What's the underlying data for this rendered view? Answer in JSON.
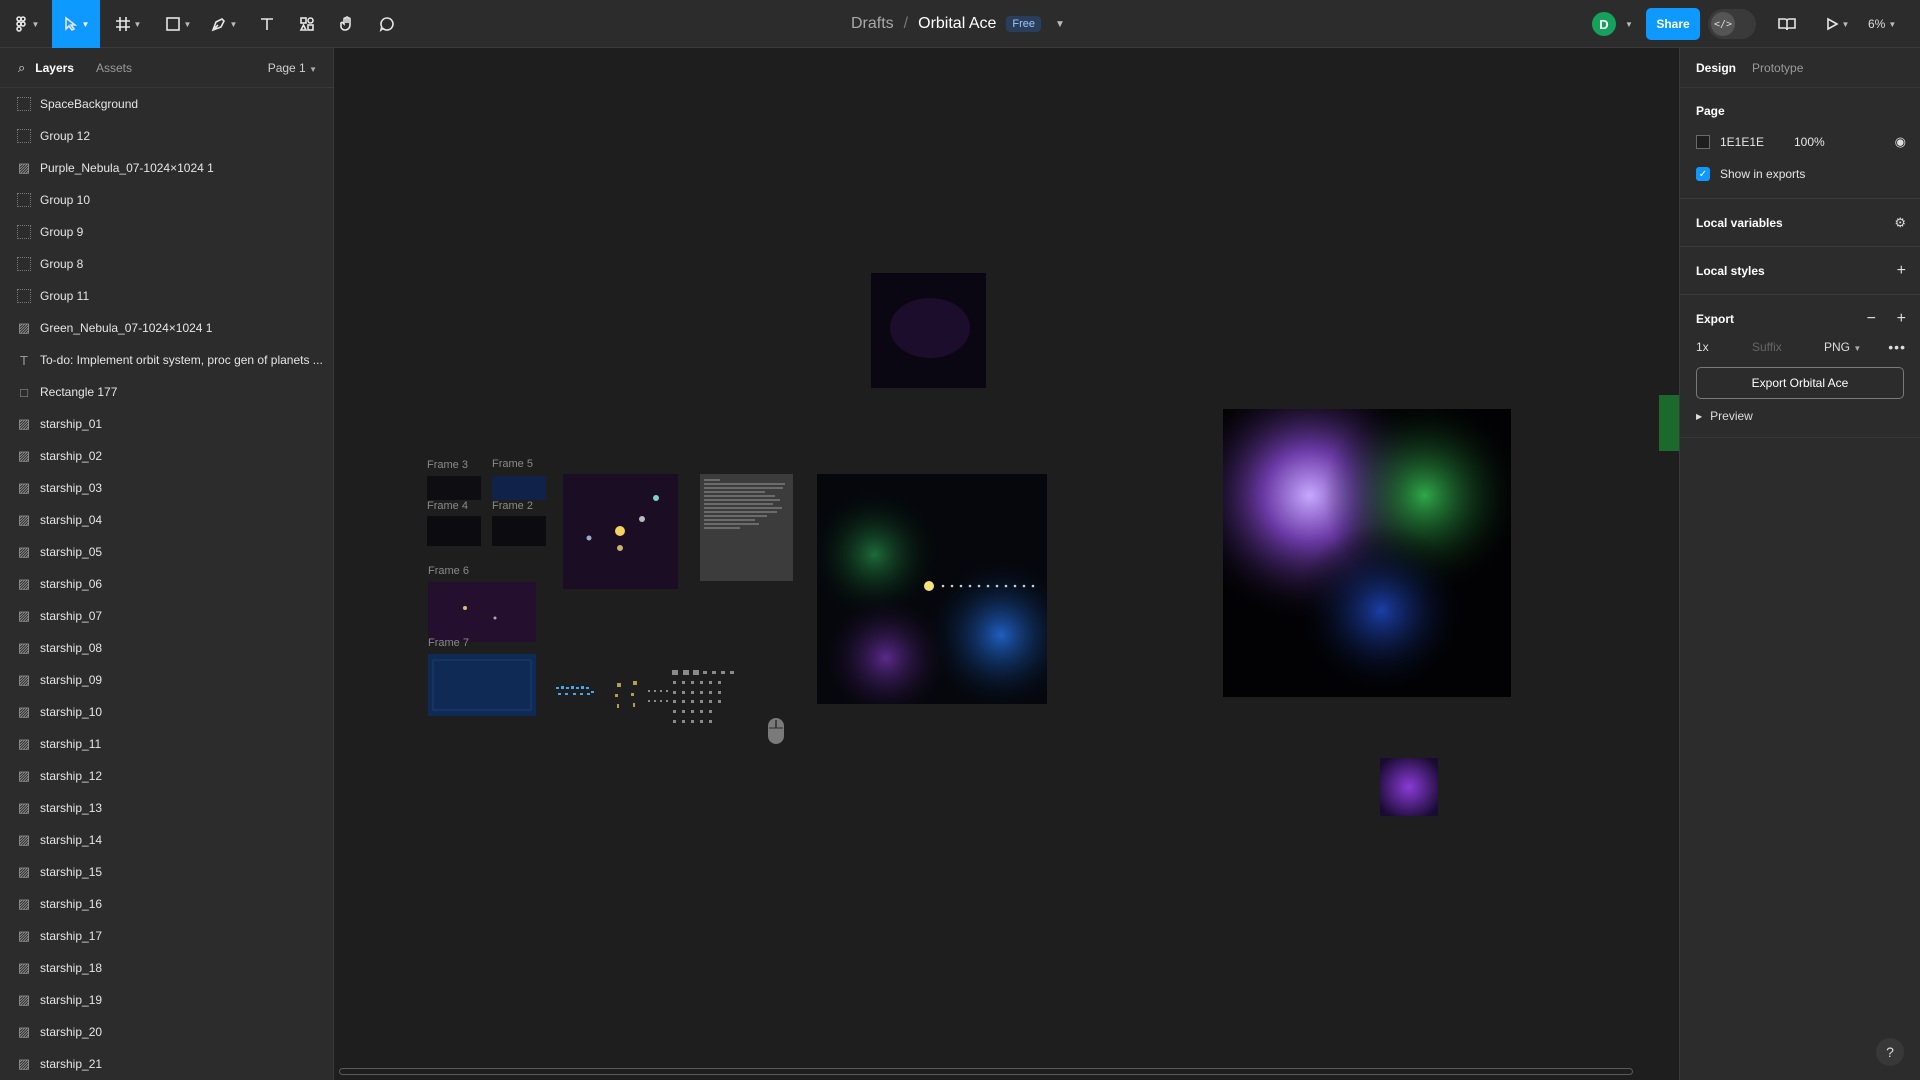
{
  "toolbar": {
    "tools": [
      "main-menu",
      "move",
      "frame",
      "shape",
      "pen",
      "text",
      "resources",
      "hand",
      "comment"
    ],
    "breadcrumb": {
      "folder": "Drafts",
      "separator": "/",
      "file": "Orbital Ace",
      "plan_badge": "Free"
    },
    "avatar_initial": "D",
    "share_label": "Share",
    "devmode_icon": "</>",
    "zoom_label": "6%"
  },
  "left_panel": {
    "tabs": {
      "layers": "Layers",
      "assets": "Assets"
    },
    "page_selector": "Page 1",
    "layers": [
      {
        "icon": "frame-icon",
        "name": "SpaceBackground"
      },
      {
        "icon": "frame-icon",
        "name": "Group 12"
      },
      {
        "icon": "image-icon",
        "name": "Purple_Nebula_07-1024×1024 1"
      },
      {
        "icon": "frame-icon",
        "name": "Group 10"
      },
      {
        "icon": "frame-icon",
        "name": "Group 9"
      },
      {
        "icon": "frame-icon",
        "name": "Group 8"
      },
      {
        "icon": "frame-icon",
        "name": "Group 11"
      },
      {
        "icon": "image-icon",
        "name": "Green_Nebula_07-1024×1024 1"
      },
      {
        "icon": "text-icon",
        "name": "To-do: Implement orbit system, proc gen of planets ..."
      },
      {
        "icon": "rectangle-icon",
        "name": "Rectangle 177"
      },
      {
        "icon": "image-icon",
        "name": "starship_01"
      },
      {
        "icon": "image-icon",
        "name": "starship_02"
      },
      {
        "icon": "image-icon",
        "name": "starship_03"
      },
      {
        "icon": "image-icon",
        "name": "starship_04"
      },
      {
        "icon": "image-icon",
        "name": "starship_05"
      },
      {
        "icon": "image-icon",
        "name": "starship_06"
      },
      {
        "icon": "image-icon",
        "name": "starship_07"
      },
      {
        "icon": "image-icon",
        "name": "starship_08"
      },
      {
        "icon": "image-icon",
        "name": "starship_09"
      },
      {
        "icon": "image-icon",
        "name": "starship_10"
      },
      {
        "icon": "image-icon",
        "name": "starship_11"
      },
      {
        "icon": "image-icon",
        "name": "starship_12"
      },
      {
        "icon": "image-icon",
        "name": "starship_13"
      },
      {
        "icon": "image-icon",
        "name": "starship_14"
      },
      {
        "icon": "image-icon",
        "name": "starship_15"
      },
      {
        "icon": "image-icon",
        "name": "starship_16"
      },
      {
        "icon": "image-icon",
        "name": "starship_17"
      },
      {
        "icon": "image-icon",
        "name": "starship_18"
      },
      {
        "icon": "image-icon",
        "name": "starship_19"
      },
      {
        "icon": "image-icon",
        "name": "starship_20"
      },
      {
        "icon": "image-icon",
        "name": "starship_21"
      }
    ]
  },
  "canvas": {
    "frame_labels": [
      "Frame 3",
      "Frame 5",
      "Frame 4",
      "Frame 2",
      "Frame 6",
      "Frame 7"
    ]
  },
  "right_panel": {
    "tabs": {
      "design": "Design",
      "prototype": "Prototype"
    },
    "page_section": {
      "title": "Page",
      "color_hex": "1E1E1E",
      "opacity": "100%",
      "show_in_exports": "Show in exports"
    },
    "local_variables": "Local variables",
    "local_styles": "Local styles",
    "export": {
      "title": "Export",
      "scale": "1x",
      "suffix_placeholder": "Suffix",
      "format": "PNG",
      "button": "Export Orbital Ace",
      "preview": "Preview"
    },
    "help": "?"
  },
  "colors": {
    "accent": "#0d99ff",
    "canvas_bg": "#1e1e1e",
    "panel_bg": "#2c2c2c",
    "avatar": "#15a15b"
  }
}
